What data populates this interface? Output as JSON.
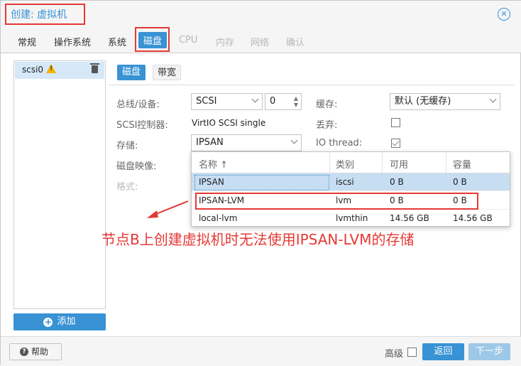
{
  "window": {
    "title": "创建: 虚拟机"
  },
  "tabs": [
    {
      "label": "常规"
    },
    {
      "label": "操作系统"
    },
    {
      "label": "系统"
    },
    {
      "label": "磁盘"
    },
    {
      "label": "CPU"
    },
    {
      "label": "内存"
    },
    {
      "label": "网络"
    },
    {
      "label": "确认"
    }
  ],
  "left_panel": {
    "item_label": "scsi0",
    "add_button": "添加"
  },
  "subtabs": {
    "disk": "磁盘",
    "bandwidth": "带宽"
  },
  "form": {
    "bus_label": "总线/设备:",
    "bus_value": "SCSI",
    "device_value": "0",
    "controller_label": "SCSI控制器:",
    "controller_value": "VirtIO SCSI single",
    "storage_label": "存储:",
    "storage_value": "IPSAN",
    "image_label": "磁盘映像:",
    "format_label": "格式:",
    "cache_label": "缓存:",
    "cache_value": "默认 (无缓存)",
    "discard_label": "丢弃:",
    "iothread_label": "IO thread:",
    "discard_checked": false,
    "iothread_checked": true
  },
  "storage_grid": {
    "columns": [
      "名称 ↑",
      "类别",
      "可用",
      "容量"
    ],
    "rows": [
      {
        "name": "IPSAN",
        "type": "iscsi",
        "avail": "0 B",
        "total": "0 B"
      },
      {
        "name": "IPSAN-LVM",
        "type": "lvm",
        "avail": "0 B",
        "total": "0 B"
      },
      {
        "name": "local-lvm",
        "type": "lvmthin",
        "avail": "14.56 GB",
        "total": "14.56 GB"
      }
    ]
  },
  "annotation": "节点B上创建虚拟机时无法使用IPSAN-LVM的存储",
  "footer": {
    "help": "帮助",
    "advanced": "高级",
    "back": "返回",
    "next": "下一步"
  },
  "colors": {
    "accent": "#3892d4",
    "highlight": "#e53935"
  }
}
